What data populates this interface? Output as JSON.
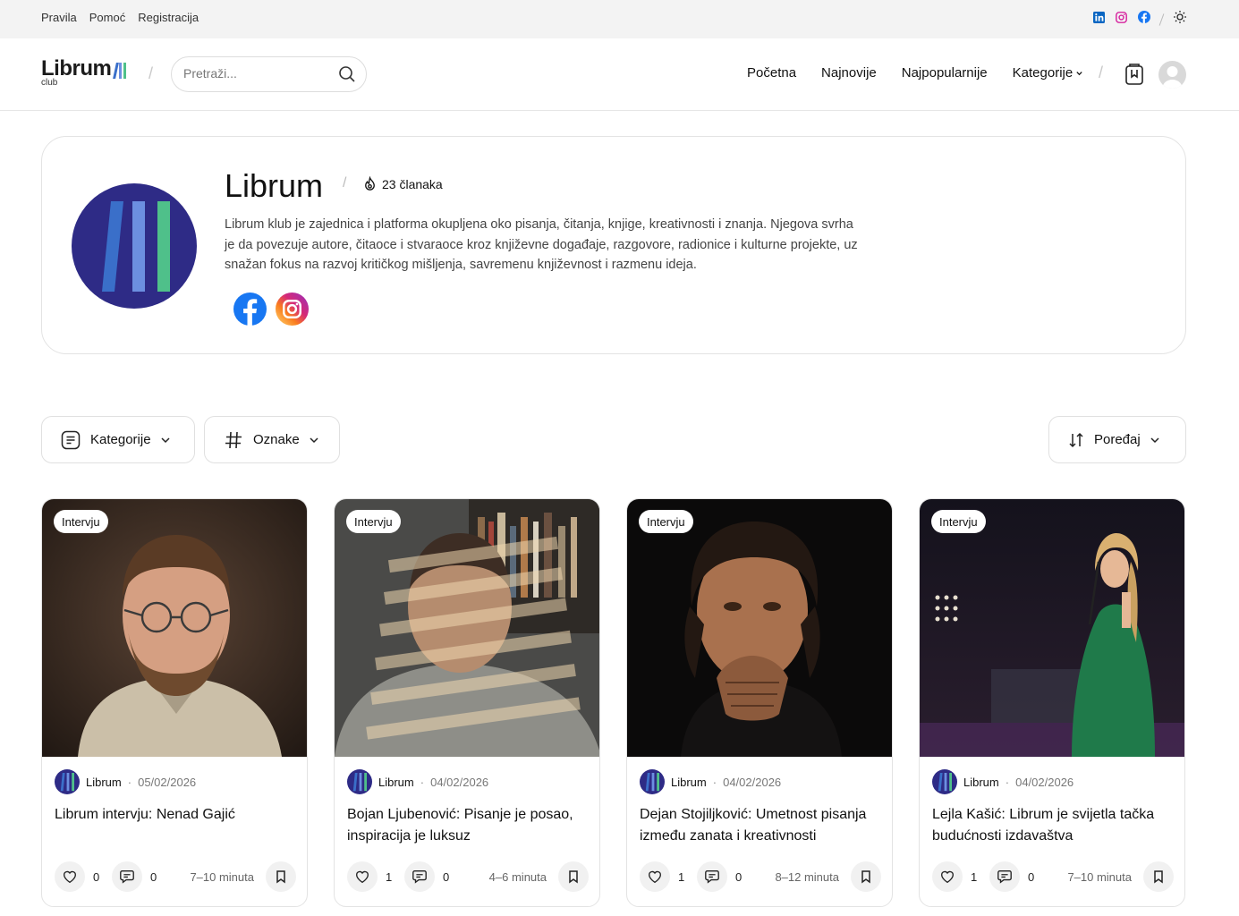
{
  "topbar": {
    "links": [
      "Pravila",
      "Pomoć",
      "Registracija"
    ],
    "icons": [
      "linkedin-icon",
      "instagram-icon",
      "facebook-icon",
      "sun-icon"
    ]
  },
  "header": {
    "logo": {
      "name": "Librum",
      "sub": "club"
    },
    "search_placeholder": "Pretraži...",
    "nav": [
      "Početna",
      "Najnovije",
      "Najpopularnije",
      "Kategorije"
    ]
  },
  "profile": {
    "name": "Librum",
    "article_count": "23 članaka",
    "description": "Librum klub je zajednica i platforma okupljena oko pisanja, čitanja, knjige, kreativnosti i znanja. Njegova svrha je da povezuje autore, čitaoce i stvaraoce kroz književne događaje, razgovore, radionice i kulturne projekte, uz snažan fokus na razvoj kritičkog mišljenja, savremenu književnost i razmenu ideja.",
    "social": [
      "facebook-icon",
      "instagram-icon"
    ]
  },
  "filters": {
    "categories": "Kategorije",
    "tags": "Oznake",
    "sort": "Poređaj"
  },
  "cards": [
    {
      "badge": "Intervju",
      "author": "Librum",
      "date": "05/02/2026",
      "title": "Librum intervju: Nenad Gajić",
      "likes": "0",
      "comments": "0",
      "read_time": "7–10 minuta"
    },
    {
      "badge": "Intervju",
      "author": "Librum",
      "date": "04/02/2026",
      "title": "Bojan Ljubenović: Pisanje je posao, inspiracija je luksuz",
      "likes": "1",
      "comments": "0",
      "read_time": "4–6 minuta"
    },
    {
      "badge": "Intervju",
      "author": "Librum",
      "date": "04/02/2026",
      "title": "Dejan Stojiljković: Umetnost pisanja između zanata i kreativnosti",
      "likes": "1",
      "comments": "0",
      "read_time": "8–12 minuta"
    },
    {
      "badge": "Intervju",
      "author": "Librum",
      "date": "04/02/2026",
      "title": "Lejla Kašić: Librum je svijetla tačka budućnosti izdavaštva",
      "likes": "1",
      "comments": "0",
      "read_time": "7–10 minuta"
    }
  ],
  "colors": {
    "brand": "#2e2b86",
    "bar_blue": "#3a6fc9",
    "bar_light": "#6c8fe0",
    "bar_green": "#4fc08a"
  }
}
